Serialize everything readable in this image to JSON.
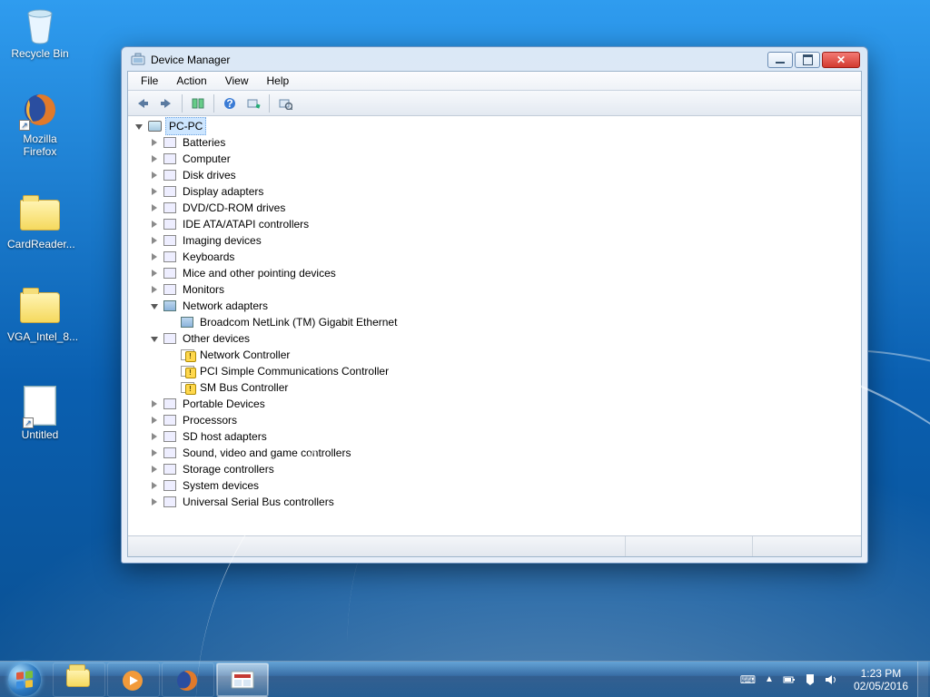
{
  "desktop_icons": [
    {
      "id": "recycle-bin",
      "label": "Recycle Bin"
    },
    {
      "id": "firefox",
      "label": "Mozilla Firefox"
    },
    {
      "id": "cardreader",
      "label": "CardReader..."
    },
    {
      "id": "vga",
      "label": "VGA_Intel_8..."
    },
    {
      "id": "untitled",
      "label": "Untitled"
    }
  ],
  "window": {
    "title": "Device Manager",
    "menu": [
      "File",
      "Action",
      "View",
      "Help"
    ],
    "toolbar_buttons": [
      "back",
      "forward",
      "show-hidden",
      "help",
      "scan",
      "properties"
    ]
  },
  "tree": {
    "root": "PC-PC",
    "categories": [
      {
        "label": "Batteries",
        "expanded": false
      },
      {
        "label": "Computer",
        "expanded": false
      },
      {
        "label": "Disk drives",
        "expanded": false
      },
      {
        "label": "Display adapters",
        "expanded": false
      },
      {
        "label": "DVD/CD-ROM drives",
        "expanded": false
      },
      {
        "label": "IDE ATA/ATAPI controllers",
        "expanded": false
      },
      {
        "label": "Imaging devices",
        "expanded": false
      },
      {
        "label": "Keyboards",
        "expanded": false
      },
      {
        "label": "Mice and other pointing devices",
        "expanded": false
      },
      {
        "label": "Monitors",
        "expanded": false
      },
      {
        "label": "Network adapters",
        "expanded": true,
        "children": [
          {
            "label": "Broadcom NetLink (TM) Gigabit Ethernet",
            "warn": false
          }
        ]
      },
      {
        "label": "Other devices",
        "expanded": true,
        "children": [
          {
            "label": "Network Controller",
            "warn": true
          },
          {
            "label": "PCI Simple Communications Controller",
            "warn": true
          },
          {
            "label": "SM Bus Controller",
            "warn": true
          }
        ]
      },
      {
        "label": "Portable Devices",
        "expanded": false
      },
      {
        "label": "Processors",
        "expanded": false
      },
      {
        "label": "SD host adapters",
        "expanded": false
      },
      {
        "label": "Sound, video and game controllers",
        "expanded": false
      },
      {
        "label": "Storage controllers",
        "expanded": false
      },
      {
        "label": "System devices",
        "expanded": false
      },
      {
        "label": "Universal Serial Bus controllers",
        "expanded": false
      }
    ]
  },
  "taskbar": {
    "pinned": [
      "explorer",
      "media-player",
      "firefox",
      "mmc-active"
    ],
    "tray_icons": [
      "keyboard",
      "up",
      "battery",
      "action-center",
      "volume"
    ],
    "clock": {
      "time": "1:23 PM",
      "date": "02/05/2016"
    }
  }
}
